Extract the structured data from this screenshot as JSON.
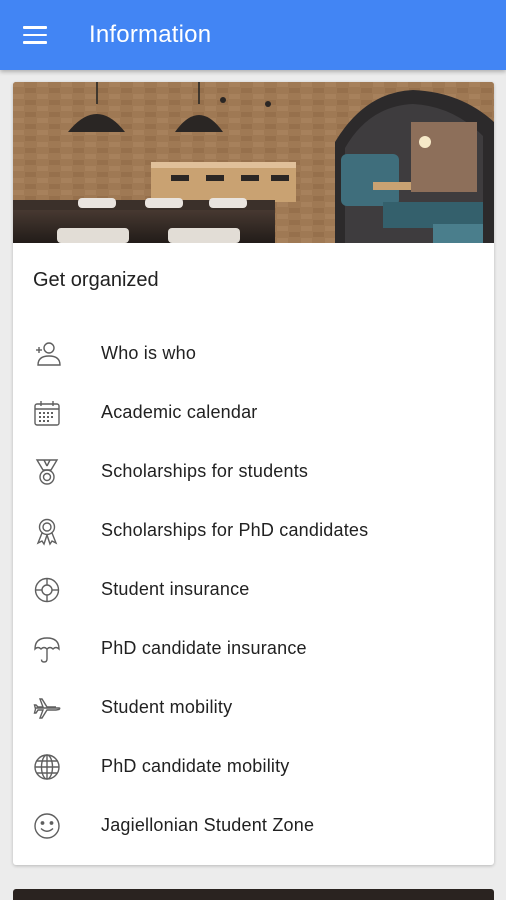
{
  "appbar": {
    "title": "Information",
    "menu_icon": "menu-icon",
    "color": "#4285f4"
  },
  "card": {
    "title": "Get organized",
    "hero_image": "restaurant interior with brick walls and pendant lamps",
    "items": [
      {
        "label": "Who is who",
        "icon": "person-add-icon"
      },
      {
        "label": "Academic calendar",
        "icon": "calendar-icon"
      },
      {
        "label": "Scholarships for students",
        "icon": "medal-icon"
      },
      {
        "label": "Scholarships for PhD candidates",
        "icon": "award-ribbon-icon"
      },
      {
        "label": "Student insurance",
        "icon": "lifebuoy-icon"
      },
      {
        "label": "PhD candidate insurance",
        "icon": "umbrella-icon"
      },
      {
        "label": "Student mobility",
        "icon": "airplane-icon"
      },
      {
        "label": "PhD candidate mobility",
        "icon": "globe-icon"
      },
      {
        "label": "Jagiellonian Student Zone",
        "icon": "smiley-icon"
      }
    ]
  }
}
